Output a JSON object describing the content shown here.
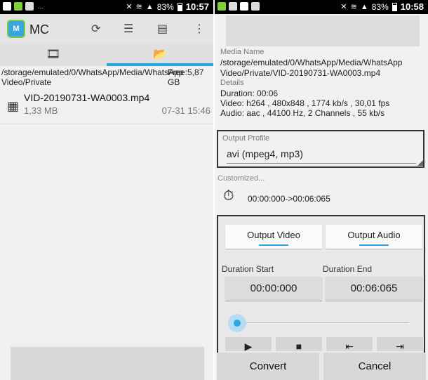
{
  "left": {
    "status": {
      "battery": "83%",
      "time": "10:57"
    },
    "app": {
      "logo_text": "M",
      "title": "MC"
    },
    "path": "/storage/emulated/0/WhatsApp/Media/WhatsApp Video/Private",
    "free_space": "Free:5,87 GB",
    "file": {
      "name": "VID-20190731-WA0003.mp4",
      "size": "1,33 MB",
      "date": "07-31 15:46"
    }
  },
  "right": {
    "status": {
      "battery": "83%",
      "time": "10:58"
    },
    "media_name_label": "Media Name",
    "media_name": "/storage/emulated/0/WhatsApp/Media/WhatsApp Video/Private/VID-20190731-WA0003.mp4",
    "details_label": "Details",
    "duration": "Duration: 00:06",
    "video": "Video: h264 , 480x848 , 1774 kb/s , 30,01 fps",
    "audio": "Audio: aac , 44100 Hz, 2 Channels , 55 kb/s",
    "output_profile_label": "Output Profile",
    "output_profile_value": "avi (mpeg4, mp3)",
    "customized_label": "Customized...",
    "time_range": "00:00:000->00:06:065",
    "tab_video": "Output Video",
    "tab_audio": "Output Audio",
    "duration_start_label": "Duration Start",
    "duration_end_label": "Duration End",
    "duration_start": "00:00:000",
    "duration_end": "00:06:065",
    "convert": "Convert",
    "cancel": "Cancel"
  }
}
